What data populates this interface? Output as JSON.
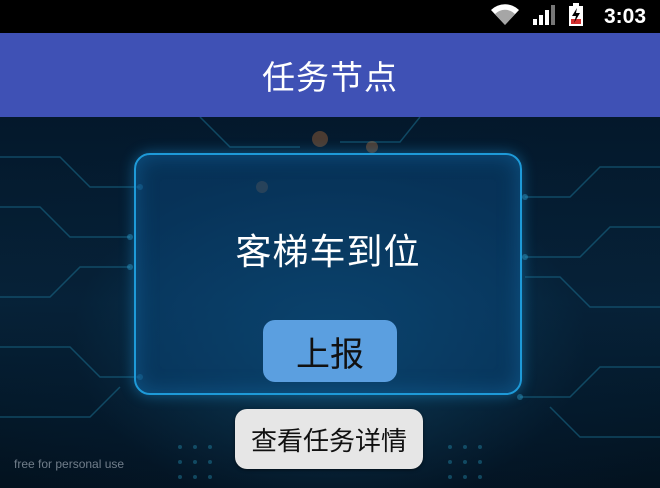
{
  "status_bar": {
    "time": "3:03",
    "icons": [
      "wifi-icon",
      "signal-icon",
      "battery-charging-icon"
    ]
  },
  "app_bar": {
    "title": "任务节点",
    "background": "#3f51b5"
  },
  "card": {
    "title": "客梯车到位",
    "report_button_label": "上报",
    "report_button_color": "#5b9fe0"
  },
  "details_button_label": "查看任务详情",
  "watermark": "free for personal use"
}
